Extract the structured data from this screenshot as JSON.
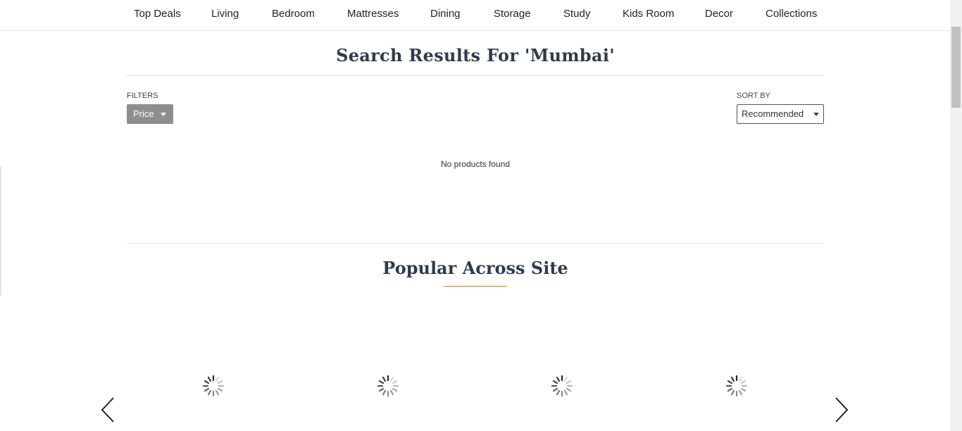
{
  "nav": {
    "items": [
      {
        "label": "Top Deals"
      },
      {
        "label": "Living"
      },
      {
        "label": "Bedroom"
      },
      {
        "label": "Mattresses"
      },
      {
        "label": "Dining"
      },
      {
        "label": "Storage"
      },
      {
        "label": "Study"
      },
      {
        "label": "Kids Room"
      },
      {
        "label": "Decor"
      },
      {
        "label": "Collections"
      }
    ]
  },
  "search": {
    "title": "Search Results For 'Mumbai'"
  },
  "filters": {
    "label": "FILTERS",
    "price_label": "Price"
  },
  "sort": {
    "label": "SORT BY",
    "selected": "Recommended"
  },
  "results": {
    "empty_message": "No products found"
  },
  "popular": {
    "title": "Popular Across Site",
    "accent_color": "#b8843a"
  }
}
